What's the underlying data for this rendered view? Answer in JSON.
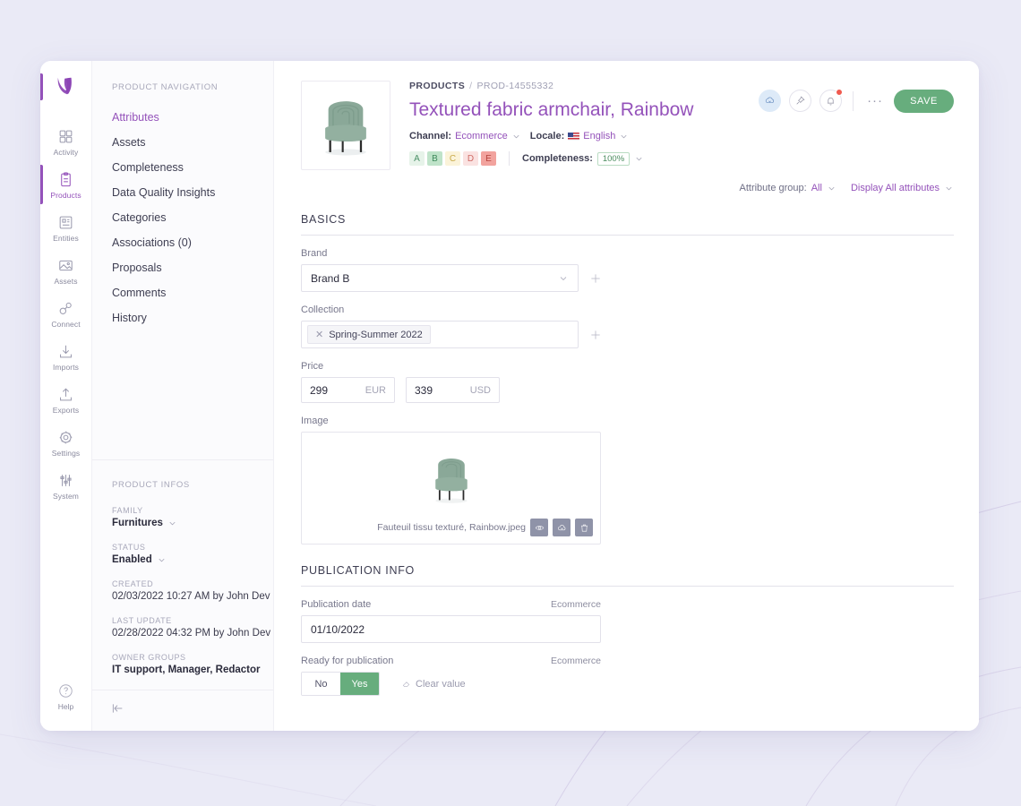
{
  "rail": {
    "logo_name": "akeneo-logo",
    "items": [
      {
        "label": "Activity",
        "icon": "grid-icon",
        "active": false
      },
      {
        "label": "Products",
        "icon": "clipboard-icon",
        "active": true
      },
      {
        "label": "Entities",
        "icon": "entities-icon",
        "active": false
      },
      {
        "label": "Assets",
        "icon": "image-icon",
        "active": false
      },
      {
        "label": "Connect",
        "icon": "link-icon",
        "active": false
      },
      {
        "label": "Imports",
        "icon": "import-download-icon",
        "active": false
      },
      {
        "label": "Exports",
        "icon": "export-upload-icon",
        "active": false
      },
      {
        "label": "Settings",
        "icon": "gear-icon",
        "active": false
      },
      {
        "label": "System",
        "icon": "sliders-icon",
        "active": false
      }
    ],
    "help_label": "Help",
    "help_icon": "question-circle-icon"
  },
  "nav": {
    "title": "PRODUCT NAVIGATION",
    "items": [
      {
        "label": "Attributes",
        "active": true
      },
      {
        "label": "Assets",
        "active": false
      },
      {
        "label": "Completeness",
        "active": false
      },
      {
        "label": "Data Quality Insights",
        "active": false
      },
      {
        "label": "Categories",
        "active": false
      },
      {
        "label": "Associations (0)",
        "active": false
      },
      {
        "label": "Proposals",
        "active": false
      },
      {
        "label": "Comments",
        "active": false
      },
      {
        "label": "History",
        "active": false
      }
    ],
    "collapse_icon": "collapse-left-icon"
  },
  "product_infos": {
    "title": "PRODUCT INFOS",
    "family_label": "FAMILY",
    "family_value": "Furnitures",
    "status_label": "STATUS",
    "status_value": "Enabled",
    "created_label": "CREATED",
    "created_value": "02/03/2022 10:27 AM by John Dev",
    "last_update_label": "LAST UPDATE",
    "last_update_value": "02/28/2022 04:32 PM by John Dev",
    "owner_groups_label": "OWNER GROUPS",
    "owner_groups_value": "IT support, Manager, Redactor"
  },
  "header": {
    "breadcrumb_root": "PRODUCTS",
    "breadcrumb_sep": "/",
    "breadcrumb_id": "PROD-14555332",
    "title": "Textured fabric armchair, Rainbow",
    "channel_label": "Channel:",
    "channel_value": "Ecommerce",
    "locale_label": "Locale:",
    "locale_value": "English",
    "completeness_label": "Completeness:",
    "completeness_value": "100%",
    "grades": [
      {
        "letter": "A",
        "bg": "#e6f3e9",
        "fg": "#4d9168"
      },
      {
        "letter": "B",
        "bg": "#bfe3c9",
        "fg": "#3f8a5c"
      },
      {
        "letter": "C",
        "bg": "#fbf3d9",
        "fg": "#c8a948"
      },
      {
        "letter": "D",
        "bg": "#fae2e1",
        "fg": "#cf6a64"
      },
      {
        "letter": "E",
        "bg": "#f2a39e",
        "fg": "#b4433d"
      }
    ],
    "actions": {
      "publish_icon": "cloud-refresh-icon",
      "pin_icon": "pin-icon",
      "bell_icon": "bell-icon",
      "more_label": "···",
      "save_label": "SAVE",
      "save_color": "#67ad7d"
    }
  },
  "filters": {
    "attribute_group_label": "Attribute group:",
    "attribute_group_value": "All",
    "display_label": "Display All attributes"
  },
  "basics": {
    "section_title": "BASICS",
    "brand_label": "Brand",
    "brand_value": "Brand B",
    "collection_label": "Collection",
    "collection_tag": "Spring-Summer 2022",
    "price_label": "Price",
    "price_eur_value": "299",
    "price_eur_currency": "EUR",
    "price_usd_value": "339",
    "price_usd_currency": "USD",
    "image_label": "Image",
    "image_filename": "Fauteuil tissu texturé, Rainbow.jpeg",
    "image_actions": [
      "eye-icon",
      "download-cloud-icon",
      "trash-icon"
    ]
  },
  "publication": {
    "section_title": "PUBLICATION INFO",
    "date_label": "Publication date",
    "date_scope": "Ecommerce",
    "date_value": "01/10/2022",
    "ready_label": "Ready for publication",
    "ready_scope": "Ecommerce",
    "toggle_no": "No",
    "toggle_yes": "Yes",
    "toggle_selected": "Yes",
    "clear_label": "Clear value",
    "clear_icon": "eraser-icon"
  },
  "theme": {
    "accent": "#9452ba",
    "green": "#67ad7d",
    "page_bg": "#eaeaf6"
  }
}
